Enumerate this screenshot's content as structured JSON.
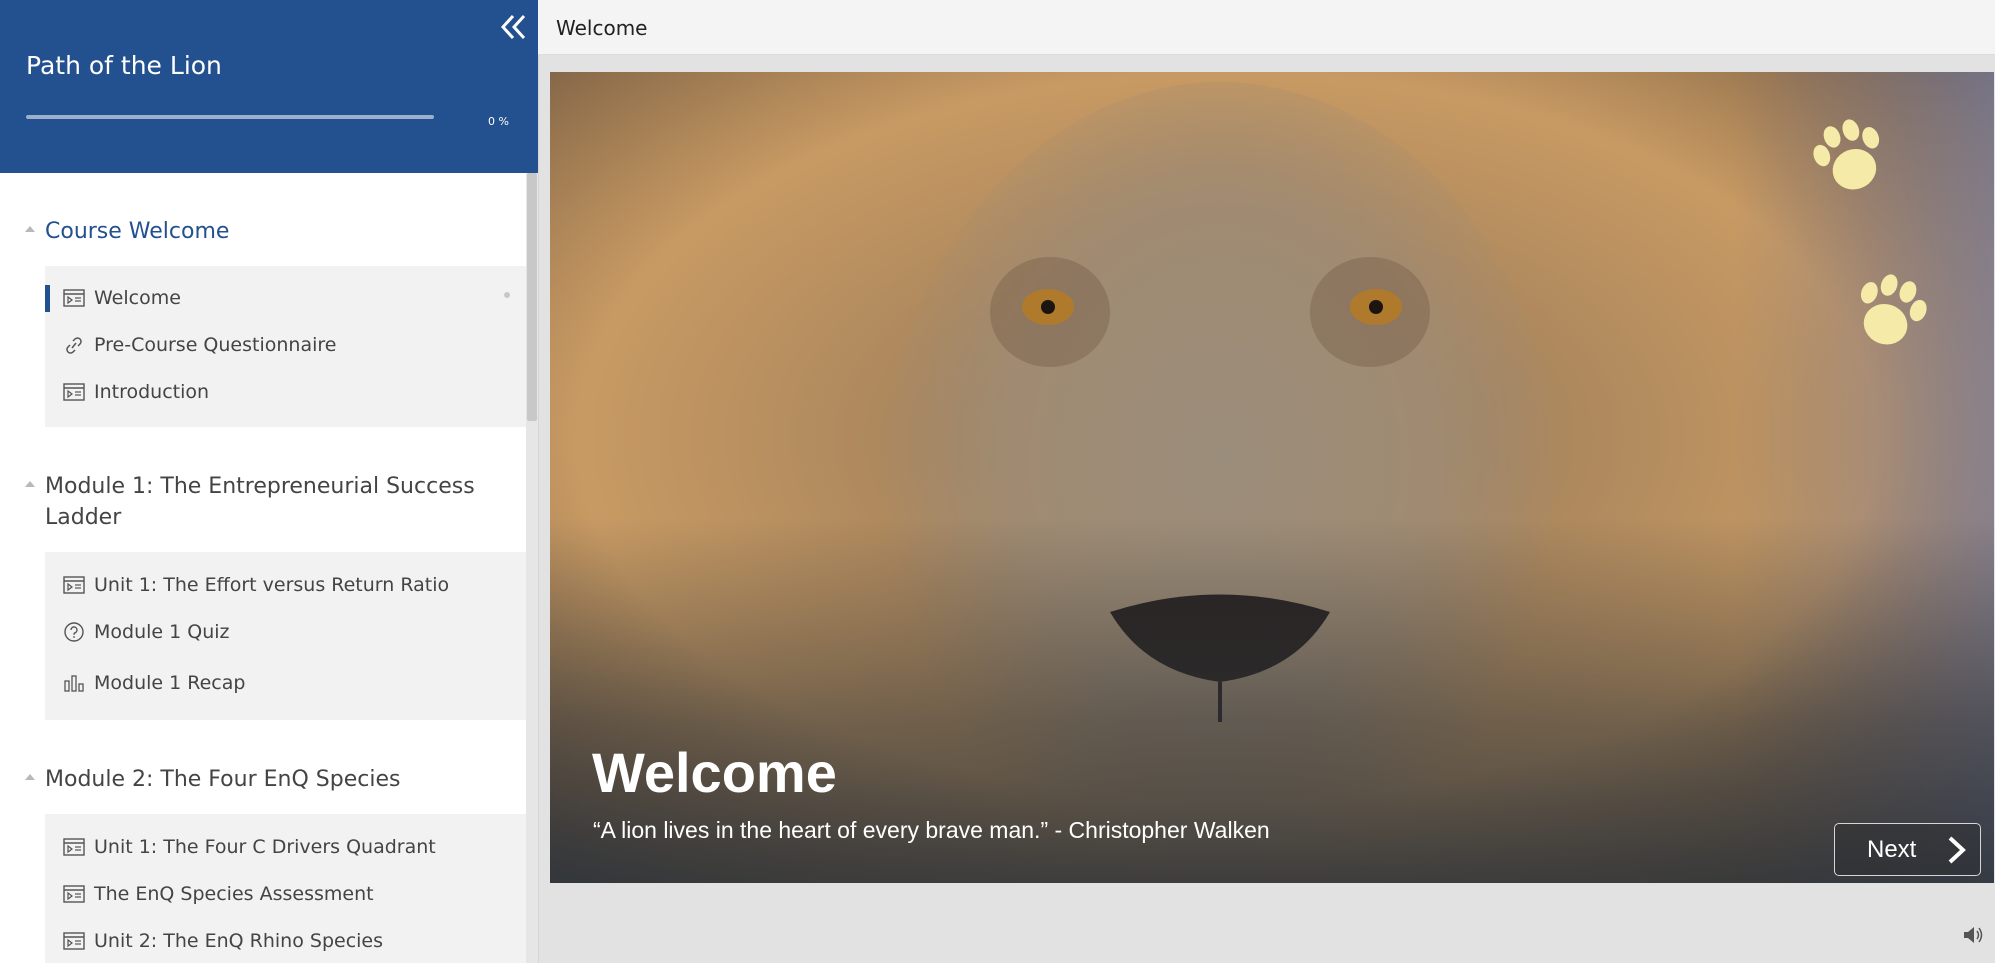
{
  "course": {
    "title": "Path of the Lion",
    "progress_label": "0 %",
    "progress": 0
  },
  "topbar": {
    "title": "Welcome"
  },
  "sections": [
    {
      "title": "Course Welcome",
      "lessons": [
        {
          "label": "Welcome",
          "icon": "slides-icon"
        },
        {
          "label": "Pre-Course Questionnaire",
          "icon": "link-icon"
        },
        {
          "label": "Introduction",
          "icon": "slides-icon"
        }
      ]
    },
    {
      "title": "Module 1: The Entrepreneurial Success Ladder",
      "lessons": [
        {
          "label": "Unit 1: The Effort versus Return Ratio",
          "icon": "slides-icon"
        },
        {
          "label": "Module 1 Quiz",
          "icon": "question-icon"
        },
        {
          "label": "Module 1 Recap",
          "icon": "bar-chart-icon"
        }
      ]
    },
    {
      "title": "Module 2: The Four EnQ Species",
      "lessons": [
        {
          "label": "Unit 1: The Four C Drivers Quadrant",
          "icon": "slides-icon"
        },
        {
          "label": "The EnQ Species Assessment",
          "icon": "slides-icon"
        },
        {
          "label": "Unit 2: The EnQ Rhino Species",
          "icon": "slides-icon"
        }
      ]
    }
  ],
  "slide": {
    "heading": "Welcome",
    "quote": "“A lion lives in the heart of every brave man.” - Christopher Walken",
    "next_label": "Next"
  },
  "colors": {
    "brand": "#23508e",
    "paw": "#f6eaa8"
  }
}
